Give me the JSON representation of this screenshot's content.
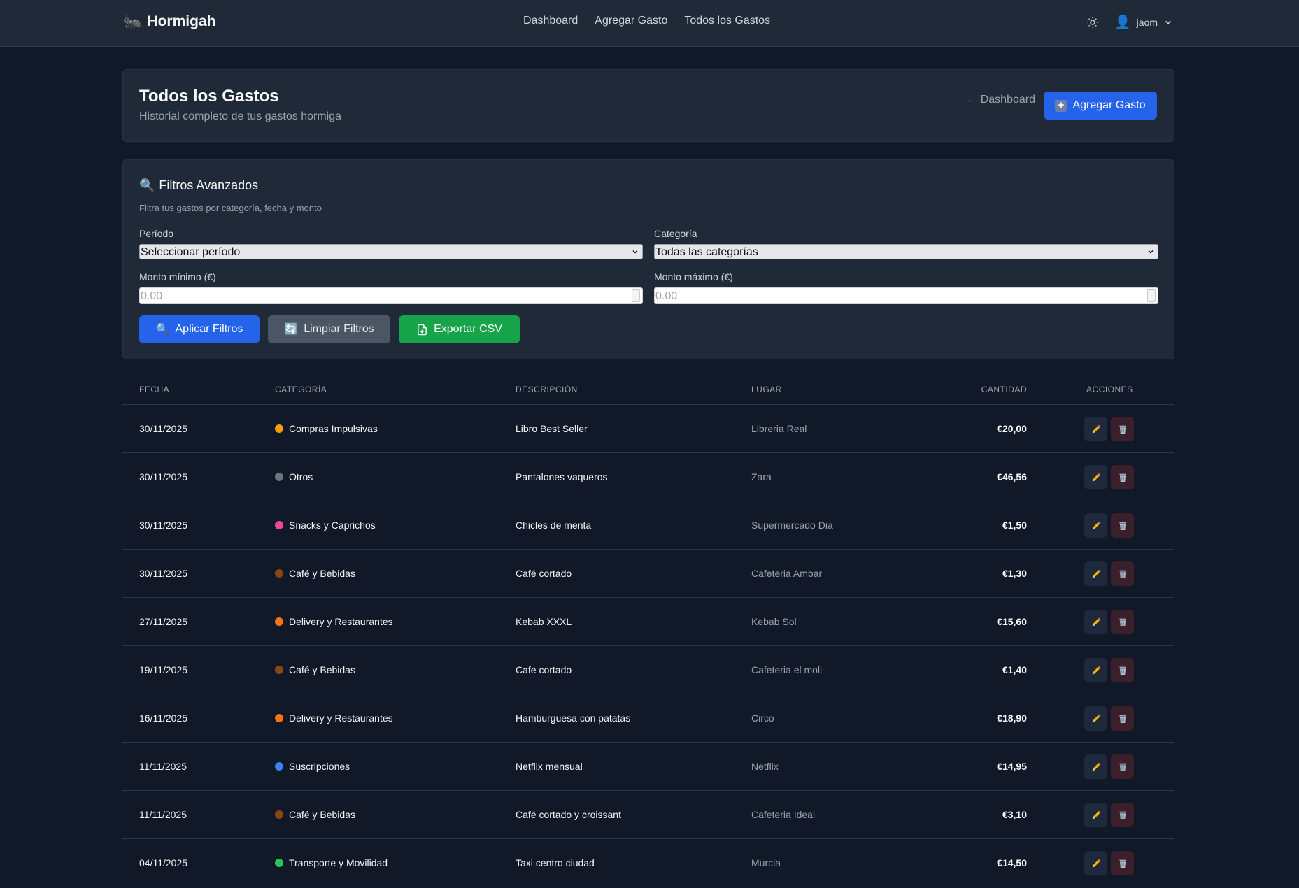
{
  "nav": {
    "brand": "Hormigah",
    "links": [
      "Dashboard",
      "Agregar Gasto",
      "Todos los Gastos"
    ],
    "user": "jaom"
  },
  "header": {
    "title": "Todos los Gastos",
    "subtitle": "Historial completo de tus gastos hormiga",
    "back_label": "← Dashboard",
    "add_label": "Agregar Gasto"
  },
  "filters": {
    "title": "Filtros Avanzados",
    "description": "Filtra tus gastos por categoría, fecha y monto",
    "period_label": "Período",
    "period_value": "Seleccionar período",
    "category_label": "Categoría",
    "category_value": "Todas las categorías",
    "min_label": "Monto mínimo (€)",
    "min_placeholder": "0.00",
    "max_label": "Monto máximo (€)",
    "max_placeholder": "0.00",
    "apply_label": "Aplicar Filtros",
    "clear_label": "Limpiar Filtros",
    "export_label": "Exportar CSV"
  },
  "table": {
    "headers": [
      "FECHA",
      "CATEGORÍA",
      "DESCRIPCIÓN",
      "LUGAR",
      "CANTIDAD",
      "ACCIONES"
    ],
    "rows": [
      {
        "date": "30/11/2025",
        "category": "Compras Impulsivas",
        "color": "#f59e0b",
        "description": "Libro Best Seller",
        "place": "Libreria Real",
        "amount": "€20,00"
      },
      {
        "date": "30/11/2025",
        "category": "Otros",
        "color": "#6b7280",
        "description": "Pantalones vaqueros",
        "place": "Zara",
        "amount": "€46,56"
      },
      {
        "date": "30/11/2025",
        "category": "Snacks y Caprichos",
        "color": "#ec4899",
        "description": "Chicles de menta",
        "place": "Supermercado Dia",
        "amount": "€1,50"
      },
      {
        "date": "30/11/2025",
        "category": "Café y Bebidas",
        "color": "#8b4513",
        "description": "Café cortado",
        "place": "Cafeteria Ambar",
        "amount": "€1,30"
      },
      {
        "date": "27/11/2025",
        "category": "Delivery y Restaurantes",
        "color": "#f97316",
        "description": "Kebab XXXL",
        "place": "Kebab Sol",
        "amount": "€15,60"
      },
      {
        "date": "19/11/2025",
        "category": "Café y Bebidas",
        "color": "#8b4513",
        "description": "Cafe cortado",
        "place": "Cafeteria el moli",
        "amount": "€1,40"
      },
      {
        "date": "16/11/2025",
        "category": "Delivery y Restaurantes",
        "color": "#f97316",
        "description": "Hamburguesa con patatas",
        "place": "Circo",
        "amount": "€18,90"
      },
      {
        "date": "11/11/2025",
        "category": "Suscripciones",
        "color": "#3b82f6",
        "description": "Netflix mensual",
        "place": "Netflix",
        "amount": "€14,95"
      },
      {
        "date": "11/11/2025",
        "category": "Café y Bebidas",
        "color": "#8b4513",
        "description": "Café cortado y croissant",
        "place": "Cafeteria Ideal",
        "amount": "€3,10"
      },
      {
        "date": "04/11/2025",
        "category": "Transporte y Movilidad",
        "color": "#22c55e",
        "description": "Taxi centro ciudad",
        "place": "Murcia",
        "amount": "€14,50"
      }
    ]
  }
}
